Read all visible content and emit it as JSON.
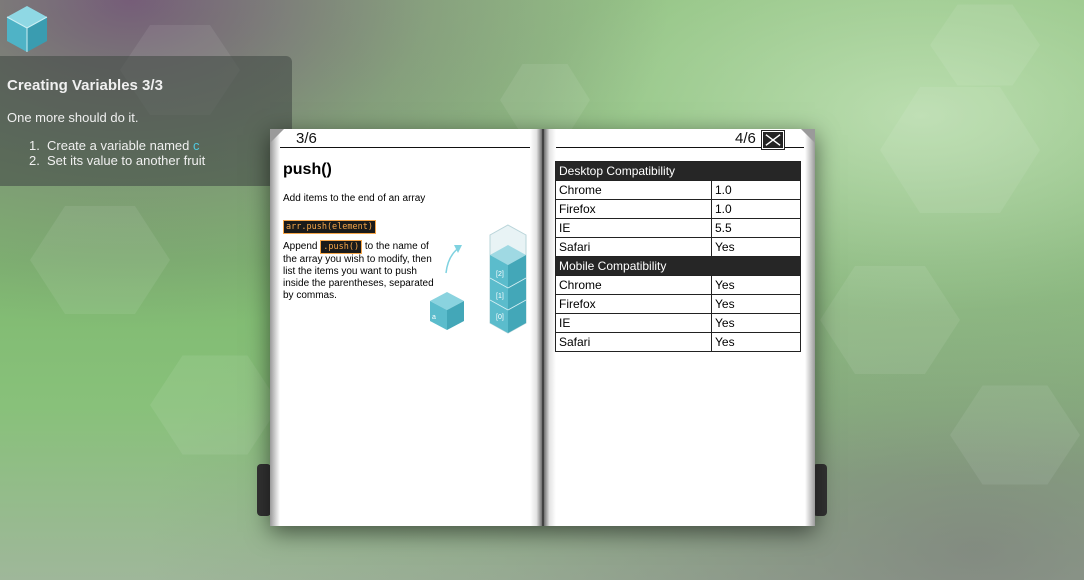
{
  "instructions": {
    "title": "Creating Variables 3/3",
    "subtitle": "One more should do it.",
    "steps": [
      {
        "num": "1.",
        "text": "Create a variable named ",
        "highlight": "c"
      },
      {
        "num": "2.",
        "text": "Set its value to another fruit",
        "highlight": ""
      }
    ]
  },
  "book": {
    "left_page_number": "3/6",
    "right_page_number": "4/6",
    "method_title": "push()",
    "method_description": "Add items to the end of an array",
    "syntax": "arr.push(element)",
    "explanation": {
      "before": "Append ",
      "code": ".push()",
      "after": " to the name of the array you wish to modify, then list the items you want to push inside the parentheses, separated by commas."
    },
    "illustration": {
      "cube_label": "a",
      "stack_labels": [
        "[2]",
        "[1]",
        "[0]"
      ]
    },
    "desktop_table": {
      "header": "Desktop Compatibility",
      "rows": [
        {
          "browser": "Chrome",
          "value": "1.0"
        },
        {
          "browser": "Firefox",
          "value": "1.0"
        },
        {
          "browser": "IE",
          "value": "5.5"
        },
        {
          "browser": "Safari",
          "value": "Yes"
        }
      ]
    },
    "mobile_table": {
      "header": "Mobile Compatibility",
      "rows": [
        {
          "browser": "Chrome",
          "value": "Yes"
        },
        {
          "browser": "Firefox",
          "value": "Yes"
        },
        {
          "browser": "IE",
          "value": "Yes"
        },
        {
          "browser": "Safari",
          "value": "Yes"
        }
      ]
    }
  },
  "icons": {
    "logo": "cube-logo-icon",
    "close": "close-icon"
  },
  "colors": {
    "highlight": "#4fc9e0",
    "code_text": "#f5a64a",
    "cube": "#5bbccc"
  }
}
